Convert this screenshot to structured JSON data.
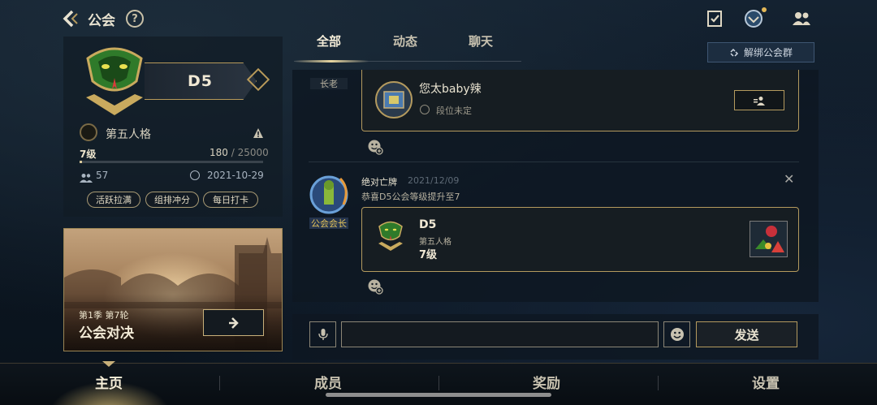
{
  "header": {
    "title": "公会",
    "help_symbol": "?"
  },
  "guild": {
    "name": "D5",
    "game": "第五人格",
    "level": "7级",
    "xp_current": "180",
    "xp_max": "25000",
    "xp_progress": 0.0072,
    "members": "57",
    "created": "2021-10-29",
    "tags": [
      "活跃拉满",
      "组排冲分",
      "每日打卡"
    ]
  },
  "battle": {
    "season": "第1季 第7轮",
    "title": "公会对决"
  },
  "tabs": [
    {
      "label": "全部",
      "active": true
    },
    {
      "label": "动态",
      "active": false
    },
    {
      "label": "聊天",
      "active": false
    }
  ],
  "unbind_button": "解绑公会群",
  "feed": {
    "first_post": {
      "role_badge": "长老",
      "user_name": "您太baby辣",
      "rank": "段位未定"
    },
    "second_post": {
      "poster": "绝对亡牌",
      "date": "2021/12/09",
      "text": "恭喜D5公会等级提升至7",
      "role_badge": "公会会长",
      "card_name": "D5",
      "card_game": "第五人格",
      "card_level": "7级"
    }
  },
  "input": {
    "value": "",
    "send_label": "发送"
  },
  "nav": [
    {
      "label": "主页",
      "active": true
    },
    {
      "label": "成员",
      "active": false
    },
    {
      "label": "奖励",
      "active": false
    },
    {
      "label": "设置",
      "active": false
    }
  ],
  "colors": {
    "accent_gold": "#b49a5e",
    "background": "#0d1620",
    "leader_gold": "#e3c35a"
  }
}
